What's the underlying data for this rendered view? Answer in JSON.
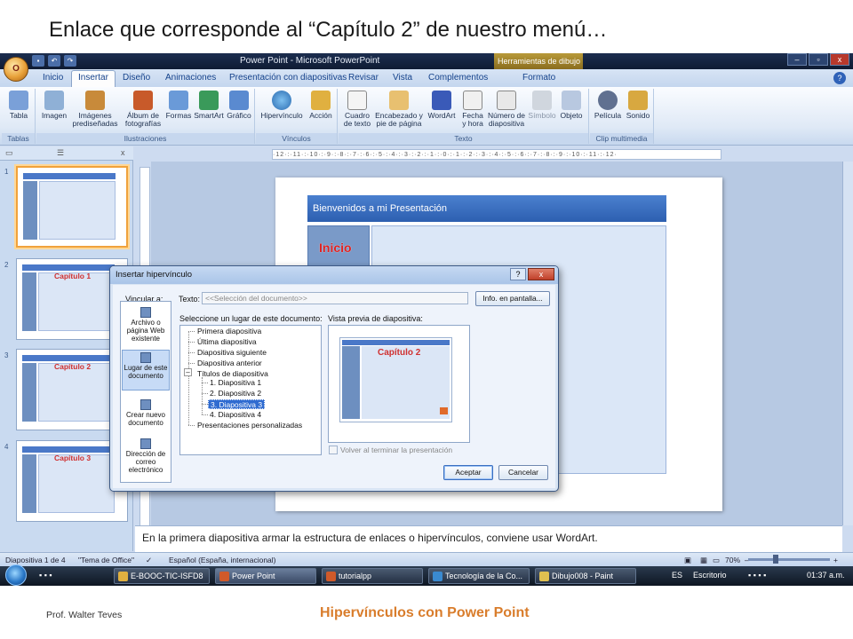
{
  "slide": {
    "heading": "Enlace que corresponde al “Capítulo 2” de nuestro menú…",
    "footer_author": "Prof. Walter Teves",
    "footer_title": "Hipervínculos con Power Point"
  },
  "window": {
    "title": "Power Point - Microsoft PowerPoint",
    "contextual_tab": "Herramientas de dibujo",
    "office_button": "O",
    "help": "?"
  },
  "tabs": [
    "Inicio",
    "Insertar",
    "Diseño",
    "Animaciones",
    "Presentación con diapositivas",
    "Revisar",
    "Vista",
    "Complementos",
    "Formato"
  ],
  "ribbon": {
    "groups": {
      "tablas": "Tablas",
      "ilustraciones": "Ilustraciones",
      "vinculos": "Vínculos",
      "texto": "Texto",
      "clip": "Clip multimedia"
    },
    "buttons": {
      "tabla": "Tabla",
      "imagen": "Imagen",
      "imagenes_pred": "Imágenes prediseñadas",
      "album": "Álbum de fotografías",
      "formas": "Formas",
      "smartart": "SmartArt",
      "grafico": "Gráfico",
      "hipervinculo": "Hipervínculo",
      "accion": "Acción",
      "cuadro": "Cuadro de texto",
      "encabezado": "Encabezado y pie de página",
      "wordart": "WordArt",
      "fecha": "Fecha y hora",
      "numero": "Número de diapositiva",
      "simbolo": "Símbolo",
      "objeto": "Objeto",
      "pelicula": "Película",
      "sonido": "Sonido"
    }
  },
  "ruler": "·12·:·11·:·10·:·9·:·8·:·7·:·6·:·5·:·4·:·3·:·2·:·1·:·0·:·1·:·2·:·3·:·4·:·5·:·6·:·7·:·8·:·9·:·10·:·11·:·12·",
  "thumbnails": [
    {
      "num": "1",
      "caption": ""
    },
    {
      "num": "2",
      "caption": "Capítulo 1"
    },
    {
      "num": "3",
      "caption": "Capítulo 2"
    },
    {
      "num": "4",
      "caption": "Capítulo 3"
    }
  ],
  "editslide": {
    "header": "Bienvenidos a mi Presentación",
    "inicio": "Inicio"
  },
  "notes": "En la primera diapositiva armar la estructura de enlaces o hipervínculos, conviene usar WordArt.",
  "status": {
    "slide": "Diapositiva 1 de 4",
    "theme": "\"Tema de Office\"",
    "lang": "Español (España, internacional)",
    "zoom": "70%"
  },
  "taskbar": {
    "items": [
      "E-BOOC-TIC-ISFD8",
      "Power Point",
      "tutorialpp",
      "Tecnología de la Co...",
      "Dibujo008 - Paint"
    ],
    "lang": "ES",
    "desk": "Escritorio",
    "time": "01:37 a.m."
  },
  "dialog": {
    "title": "Insertar hipervínculo",
    "help": "?",
    "close": "x",
    "vincular": "Vincular a:",
    "texto_label": "Texto:",
    "texto_value": "<<Selección del documento>>",
    "info_btn": "Info. en pantalla...",
    "lugar_label": "Seleccione un lugar de este documento:",
    "preview_label": "Vista previa de diapositiva:",
    "preview_caption": "Capítulo 2",
    "volver": "Volver al terminar la presentación",
    "aceptar": "Aceptar",
    "cancelar": "Cancelar",
    "link_options": [
      "Archivo o página Web existente",
      "Lugar de este documento",
      "Crear nuevo documento",
      "Dirección de correo electrónico"
    ],
    "tree": {
      "primera": "Primera diapositiva",
      "ultima": "Última diapositiva",
      "siguiente": "Diapositiva siguiente",
      "anterior": "Diapositiva anterior",
      "titulos": "Títulos de diapositiva",
      "s1": "1. Diapositiva 1",
      "s2": "2. Diapositiva 2",
      "s3": "3. Diapositiva 3",
      "s4": "4. Diapositiva 4",
      "personalizadas": "Presentaciones personalizadas"
    }
  }
}
